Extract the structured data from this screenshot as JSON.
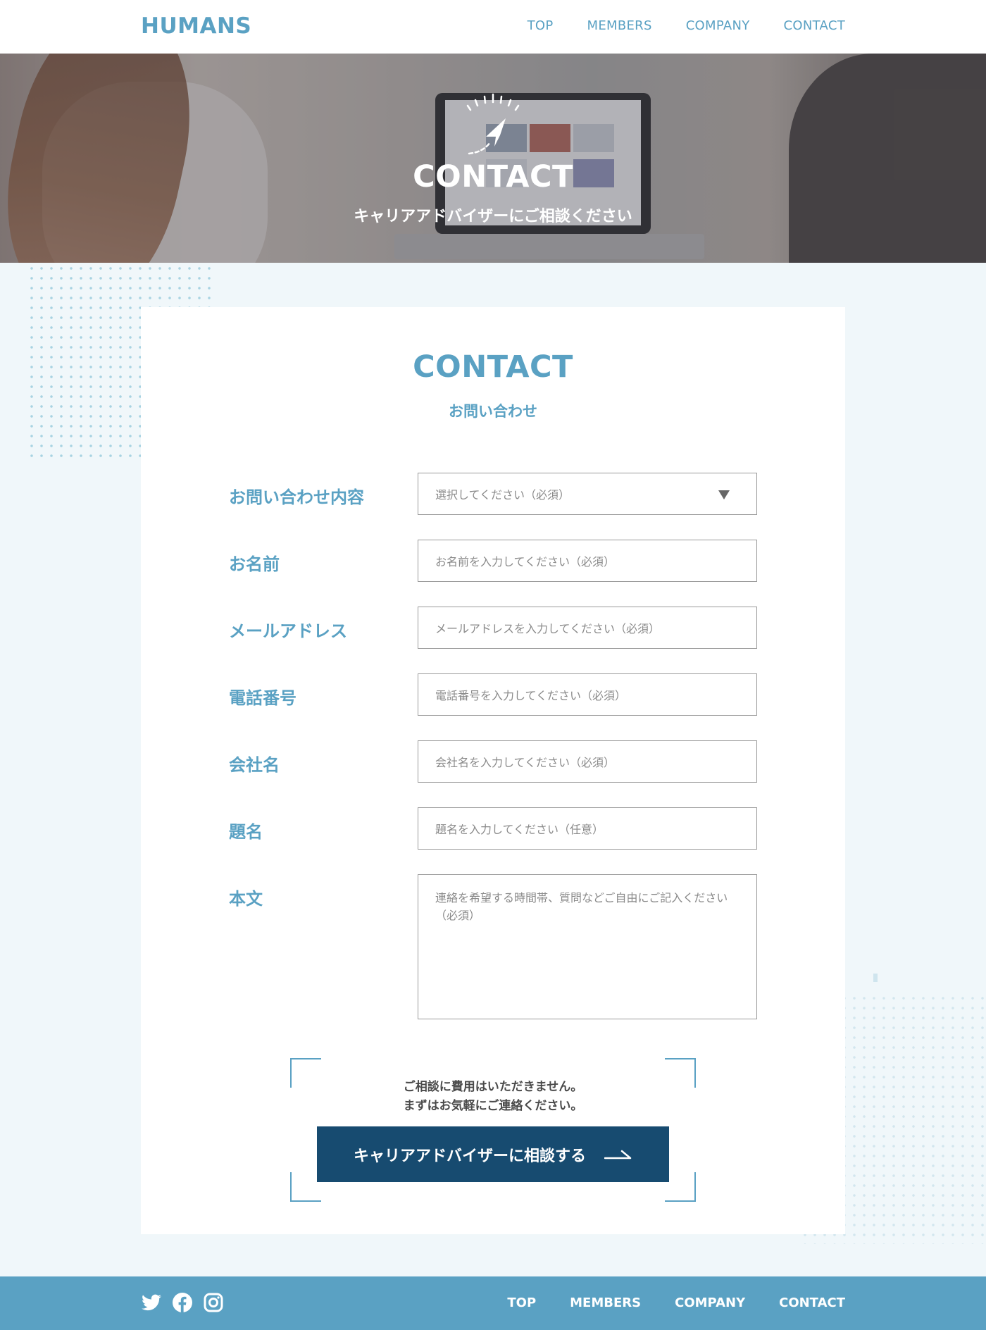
{
  "header": {
    "logo": "HUMANS",
    "nav": [
      "TOP",
      "MEMBERS",
      "COMPANY",
      "CONTACT"
    ]
  },
  "hero": {
    "title": "CONTACT",
    "subtitle": "キャリアアドバイザーにご相談ください"
  },
  "card": {
    "title": "CONTACT",
    "subtitle": "お問い合わせ"
  },
  "form": {
    "fields": [
      {
        "label": "お問い合わせ内容",
        "placeholder": "選択してください（必須）",
        "type": "select"
      },
      {
        "label": "お名前",
        "placeholder": "お名前を入力してください（必須）",
        "type": "text"
      },
      {
        "label": "メールアドレス",
        "placeholder": "メールアドレスを入力してください（必須）",
        "type": "email"
      },
      {
        "label": "電話番号",
        "placeholder": "電話番号を入力してください（必須）",
        "type": "tel"
      },
      {
        "label": "会社名",
        "placeholder": "会社名を入力してください（必須）",
        "type": "text"
      },
      {
        "label": "題名",
        "placeholder": "題名を入力してください（任意）",
        "type": "text"
      },
      {
        "label": "本文",
        "placeholder_line1": "連絡を希望する時間帯、質問などご自由にご記入ください",
        "placeholder_line2": "（必須）",
        "type": "textarea"
      }
    ]
  },
  "cta": {
    "note_line1": "ご相談に費用はいただきません。",
    "note_line2": "まずはお気軽にご連絡ください。",
    "button_label": "キャリアアドバイザーに相談する"
  },
  "footer": {
    "social": [
      "twitter-icon",
      "facebook-icon",
      "instagram-icon"
    ],
    "nav": [
      "TOP",
      "MEMBERS",
      "COMPANY",
      "CONTACT"
    ]
  },
  "colors": {
    "accent": "#5aa1c3",
    "button": "#174b70",
    "background": "#f0f7fa"
  }
}
